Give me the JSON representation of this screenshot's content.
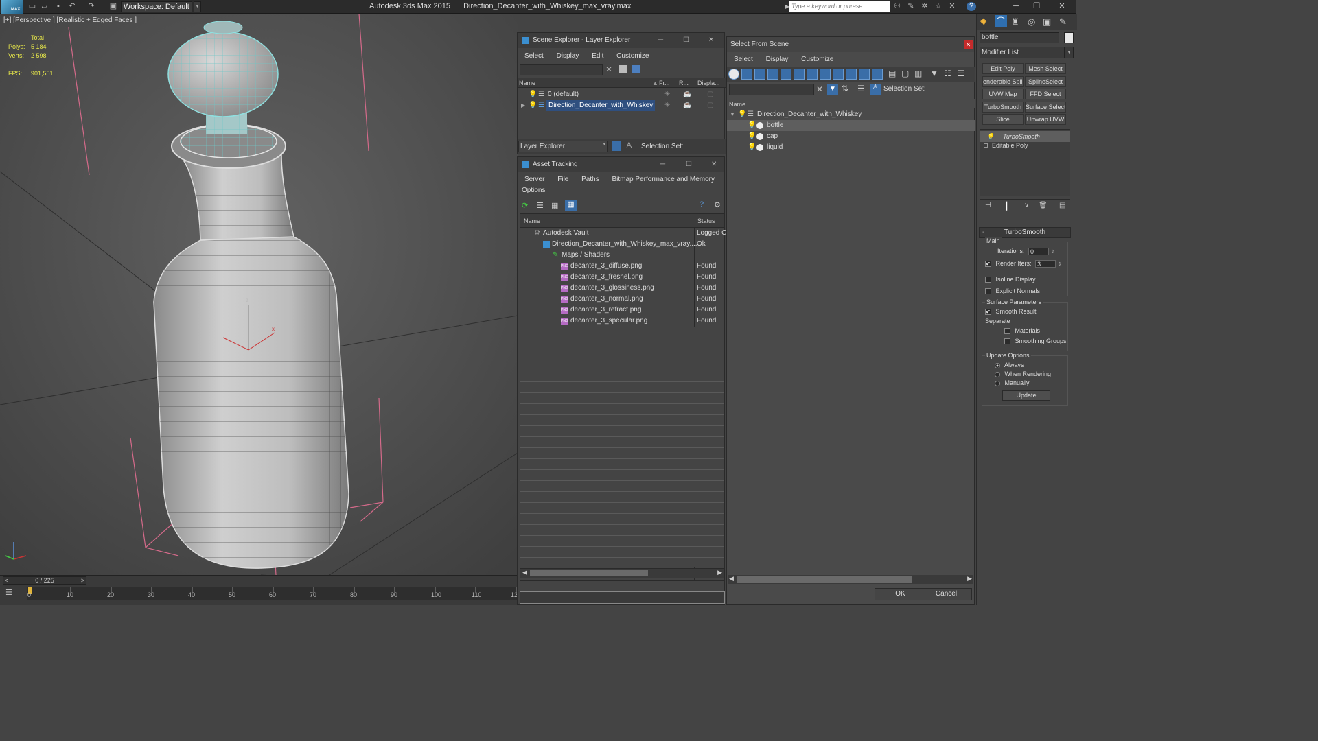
{
  "app": {
    "logo_text": "MAX",
    "workspace_label": "Workspace: Default",
    "title": "Autodesk 3ds Max  2015",
    "filename": "Direction_Decanter_with_Whiskey_max_vray.max",
    "search_placeholder": "Type a keyword or phrase"
  },
  "viewport": {
    "label": "[+] [Perspective ] [Realistic + Edged Faces ]",
    "stats_total_label": "Total",
    "polys_label": "Polys:",
    "polys_value": "5 184",
    "verts_label": "Verts:",
    "verts_value": "2 598",
    "fps_label": "FPS:",
    "fps_value": "901,551"
  },
  "timeline": {
    "frame_display": "0 / 225",
    "prev": "<",
    "next": ">",
    "ticks": [
      "0",
      "10",
      "20",
      "30",
      "40",
      "50",
      "60",
      "70",
      "80",
      "90",
      "100",
      "110",
      "12"
    ]
  },
  "layer_explorer": {
    "title": "Scene Explorer - Layer Explorer",
    "menu": [
      "Select",
      "Display",
      "Edit",
      "Customize"
    ],
    "columns": {
      "name": "Name",
      "frozen": "Fr...",
      "render": "R...",
      "display": "Displa..."
    },
    "rows": [
      {
        "name": "0 (default)"
      },
      {
        "name": "Direction_Decanter_with_Whiskey"
      }
    ],
    "footer_dropdown": "Layer Explorer",
    "selection_set_label": "Selection Set:"
  },
  "asset_tracking": {
    "title": "Asset Tracking",
    "menu": [
      "Server",
      "File",
      "Paths",
      "Bitmap Performance and Memory",
      "Options"
    ],
    "columns": {
      "name": "Name",
      "status": "Status"
    },
    "rows": [
      {
        "name": "Autodesk Vault",
        "status": "Logged C"
      },
      {
        "name": "Direction_Decanter_with_Whiskey_max_vray....",
        "status": "Ok"
      },
      {
        "name": "Maps / Shaders",
        "status": ""
      },
      {
        "name": "decanter_3_diffuse.png",
        "status": "Found"
      },
      {
        "name": "decanter_3_fresnel.png",
        "status": "Found"
      },
      {
        "name": "decanter_3_glossiness.png",
        "status": "Found"
      },
      {
        "name": "decanter_3_normal.png",
        "status": "Found"
      },
      {
        "name": "decanter_3_refract.png",
        "status": "Found"
      },
      {
        "name": "decanter_3_specular.png",
        "status": "Found"
      }
    ]
  },
  "select_from_scene": {
    "title": "Select From Scene",
    "menu": [
      "Select",
      "Display",
      "Customize"
    ],
    "selection_set_label": "Selection Set:",
    "column_name": "Name",
    "tree": [
      {
        "name": "Direction_Decanter_with_Whiskey"
      },
      {
        "name": "bottle"
      },
      {
        "name": "cap"
      },
      {
        "name": "liquid"
      }
    ],
    "ok": "OK",
    "cancel": "Cancel"
  },
  "command_panel": {
    "object_name": "bottle",
    "modifier_list": "Modifier List",
    "buttons": [
      "Edit Poly",
      "Mesh Select",
      "enderable Splin",
      "SplineSelect",
      "UVW Map",
      "FFD Select",
      "TurboSmooth",
      "Surface Select",
      "Slice",
      "Unwrap UVW"
    ],
    "stack": [
      "TurboSmooth",
      "Editable Poly"
    ],
    "rollout_title": "TurboSmooth",
    "main_label": "Main",
    "iterations_label": "Iterations:",
    "iterations_value": "0",
    "render_iters_label": "Render Iters:",
    "render_iters_value": "3",
    "isoline_label": "Isoline Display",
    "explicit_normals_label": "Explicit Normals",
    "surface_params_label": "Surface Parameters",
    "smooth_result_label": "Smooth Result",
    "separate_label": "Separate",
    "materials_label": "Materials",
    "smoothing_groups_label": "Smoothing Groups",
    "update_options_label": "Update Options",
    "always_label": "Always",
    "when_rendering_label": "When Rendering",
    "manually_label": "Manually",
    "update_button": "Update"
  }
}
